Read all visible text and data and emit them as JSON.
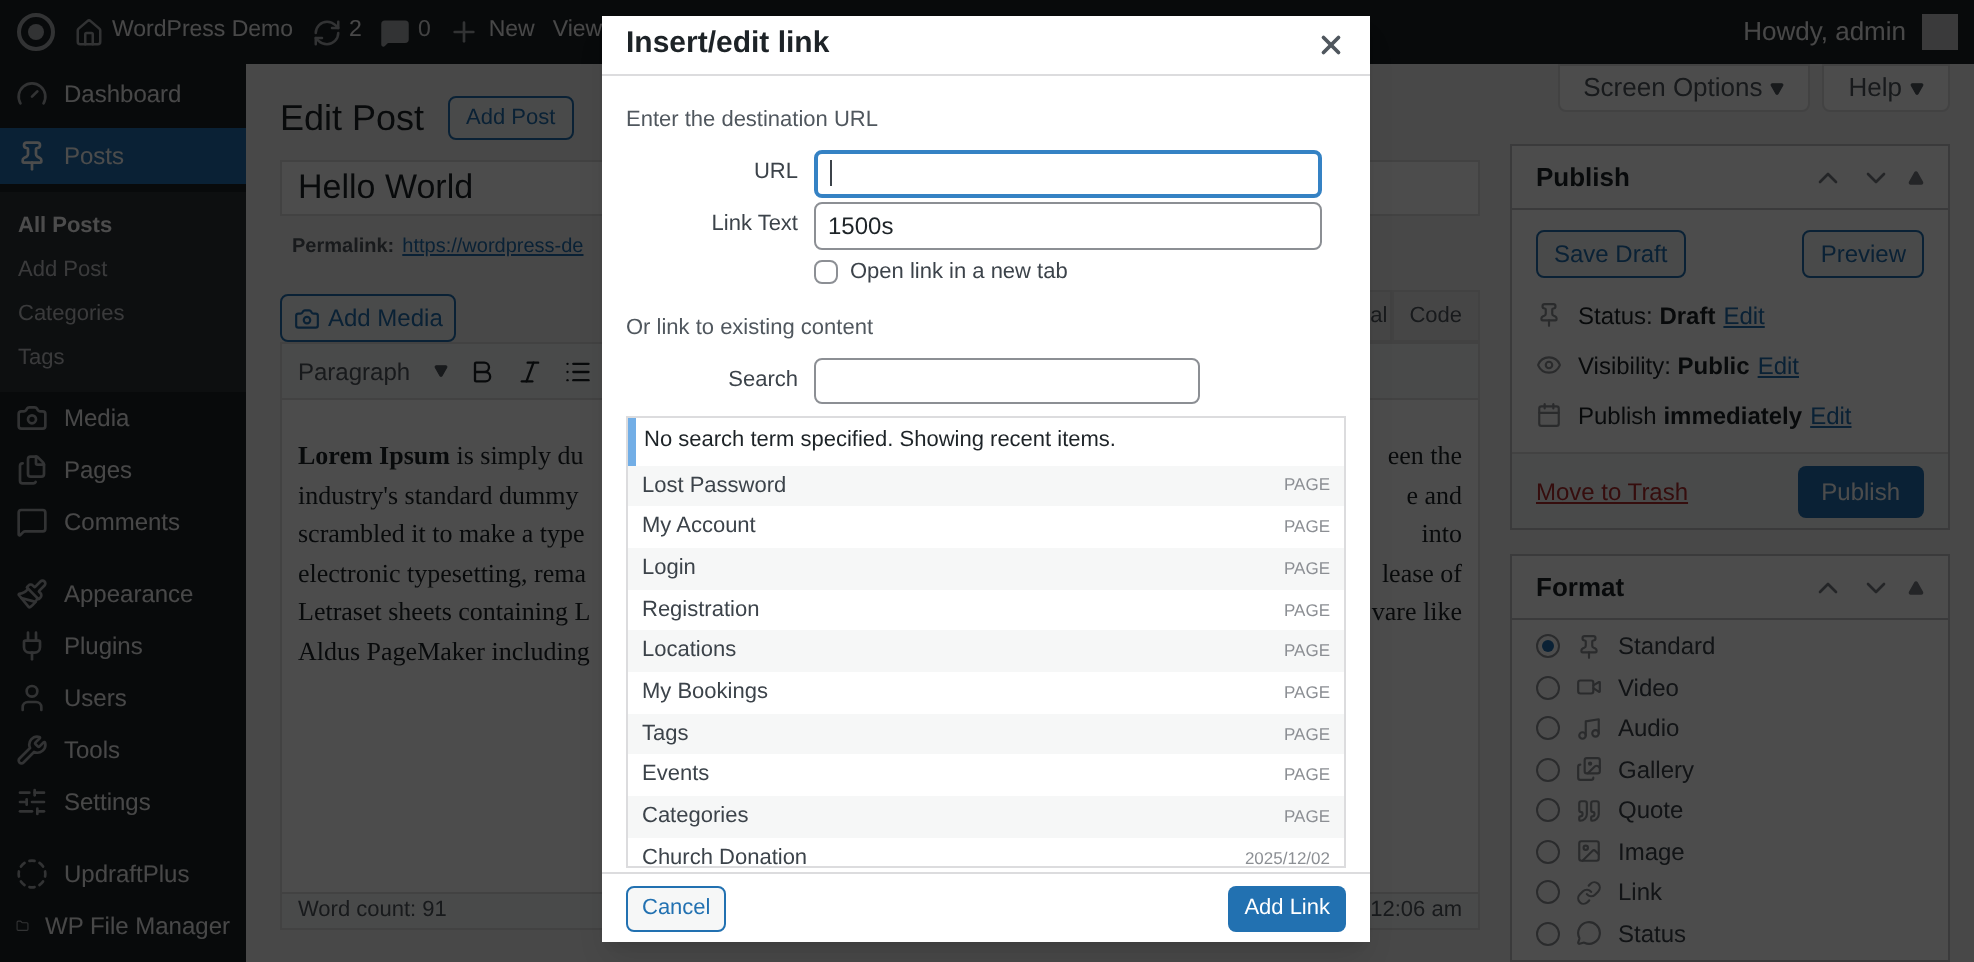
{
  "admin_bar": {
    "site": "WordPress Demo",
    "updates": "2",
    "comments": "0",
    "new": "New",
    "view": "View",
    "greeting": "Howdy, admin"
  },
  "sidebar": {
    "sections": [
      [
        {
          "label": "Dashboard",
          "selected": false
        },
        {
          "label": "Posts",
          "selected": true,
          "children": [
            {
              "label": "All Posts",
              "selected": true
            },
            {
              "label": "Add Post",
              "selected": false
            },
            {
              "label": "Categories",
              "selected": false
            },
            {
              "label": "Tags",
              "selected": false
            }
          ]
        },
        {
          "label": "Media",
          "selected": false
        },
        {
          "label": "Pages",
          "selected": false
        },
        {
          "label": "Comments",
          "selected": false
        }
      ],
      [
        {
          "label": "Appearance",
          "selected": false
        },
        {
          "label": "Plugins",
          "selected": false
        },
        {
          "label": "Users",
          "selected": false
        },
        {
          "label": "Tools",
          "selected": false
        },
        {
          "label": "Settings",
          "selected": false
        }
      ],
      [
        {
          "label": "UpdraftPlus",
          "selected": false
        },
        {
          "label": "WP File Manager",
          "selected": false
        }
      ]
    ]
  },
  "header": {
    "title": "Edit Post",
    "add_button": "Add Post",
    "screen_options": "Screen Options",
    "help": "Help"
  },
  "post": {
    "title": "Hello World",
    "permalink_label": "Permalink:",
    "permalink": "https://wordpress-de",
    "add_media": "Add Media",
    "format_select": "Paragraph",
    "tabs": [
      "al",
      "Code"
    ],
    "lines_left": [
      "**Lorem Ipsum** is simply du",
      "industry's standard dummy",
      "scrambled it to make a type",
      "electronic typesetting, rema",
      "Letraset sheets containing L",
      "Aldus PageMaker including"
    ],
    "lines_right": [
      "een the",
      "e and",
      "into",
      "lease of",
      "vare like"
    ],
    "word_count": "Word count: 91",
    "last_edited": "12:06 am"
  },
  "publish_box": {
    "title": "Publish",
    "save_draft": "Save Draft",
    "preview": "Preview",
    "meta": [
      {
        "text": "Status: **Draft**",
        "link": "Edit"
      },
      {
        "text": "Visibility: **Public**",
        "link": "Edit"
      },
      {
        "text": "Publish **immediately**",
        "link": "Edit"
      }
    ],
    "trash": "Move to Trash",
    "publish": "Publish"
  },
  "format_box": {
    "title": "Format",
    "options": [
      {
        "label": "Standard",
        "selected": true
      },
      {
        "label": "Video",
        "selected": false
      },
      {
        "label": "Audio",
        "selected": false
      },
      {
        "label": "Gallery",
        "selected": false
      },
      {
        "label": "Quote",
        "selected": false
      },
      {
        "label": "Image",
        "selected": false
      },
      {
        "label": "Link",
        "selected": false
      },
      {
        "label": "Status",
        "selected": false
      }
    ]
  },
  "dialog": {
    "title": "Insert/edit link",
    "intro": "Enter the destination URL",
    "url_label": "URL",
    "link_text_label": "Link Text",
    "link_text": "1500s",
    "new_tab": {
      "label": "Open link in a new tab",
      "checked": false
    },
    "existing": "Or link to existing content",
    "search_label": "Search",
    "notice": "No search term specified. Showing recent items.",
    "results": [
      {
        "title": "Lost Password",
        "info": "PAGE"
      },
      {
        "title": "My Account",
        "info": "PAGE"
      },
      {
        "title": "Login",
        "info": "PAGE"
      },
      {
        "title": "Registration",
        "info": "PAGE"
      },
      {
        "title": "Locations",
        "info": "PAGE"
      },
      {
        "title": "My Bookings",
        "info": "PAGE"
      },
      {
        "title": "Tags",
        "info": "PAGE"
      },
      {
        "title": "Events",
        "info": "PAGE"
      },
      {
        "title": "Categories",
        "info": "PAGE"
      },
      {
        "title": "Church Donation",
        "info": "2025/12/02"
      }
    ],
    "cancel": "Cancel",
    "add_link": "Add Link"
  }
}
